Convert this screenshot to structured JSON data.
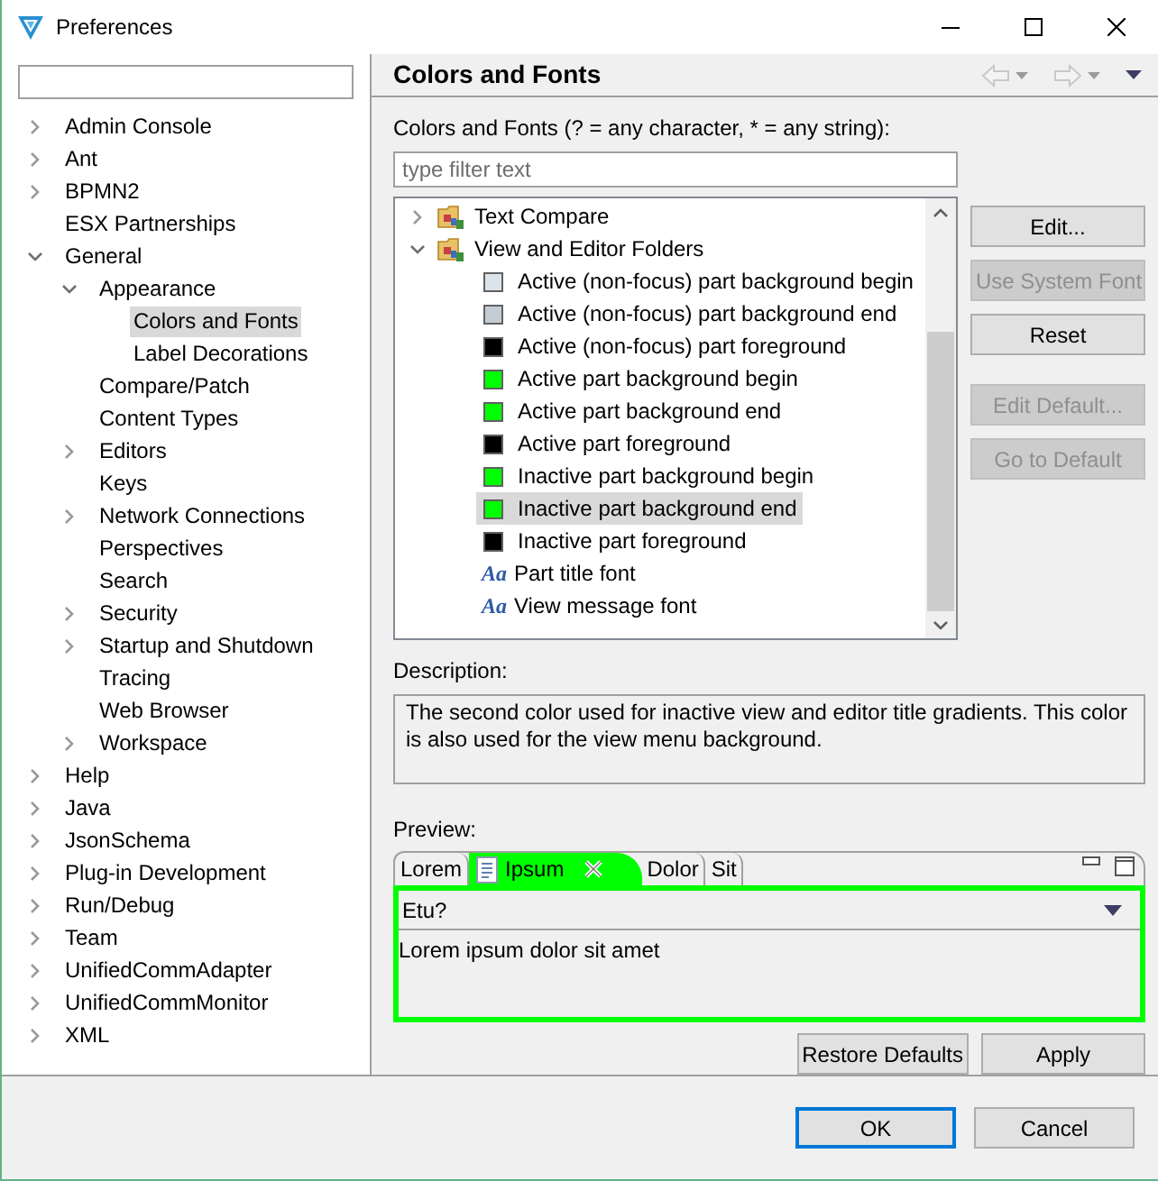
{
  "window": {
    "title": "Preferences"
  },
  "nav_tree": [
    {
      "label": "Admin Console",
      "expanded": false,
      "selected": false
    },
    {
      "label": "Ant",
      "expanded": false,
      "selected": false
    },
    {
      "label": "BPMN2",
      "expanded": false,
      "selected": false
    },
    {
      "label": "ESX Partnerships",
      "selected": false
    },
    {
      "label": "General",
      "expanded": true,
      "selected": false,
      "children": [
        {
          "label": "Appearance",
          "expanded": true,
          "selected": false,
          "children": [
            {
              "label": "Colors and Fonts",
              "selected": true
            },
            {
              "label": "Label Decorations",
              "selected": false
            }
          ]
        },
        {
          "label": "Compare/Patch",
          "selected": false
        },
        {
          "label": "Content Types",
          "selected": false
        },
        {
          "label": "Editors",
          "expanded": false,
          "selected": false
        },
        {
          "label": "Keys",
          "selected": false
        },
        {
          "label": "Network Connections",
          "expanded": false,
          "selected": false
        },
        {
          "label": "Perspectives",
          "selected": false
        },
        {
          "label": "Search",
          "selected": false
        },
        {
          "label": "Security",
          "expanded": false,
          "selected": false
        },
        {
          "label": "Startup and Shutdown",
          "expanded": false,
          "selected": false
        },
        {
          "label": "Tracing",
          "selected": false
        },
        {
          "label": "Web Browser",
          "selected": false
        },
        {
          "label": "Workspace",
          "expanded": false,
          "selected": false
        }
      ]
    },
    {
      "label": "Help",
      "expanded": false,
      "selected": false
    },
    {
      "label": "Java",
      "expanded": false,
      "selected": false
    },
    {
      "label": "JsonSchema",
      "expanded": false,
      "selected": false
    },
    {
      "label": "Plug-in Development",
      "expanded": false,
      "selected": false
    },
    {
      "label": "Run/Debug",
      "expanded": false,
      "selected": false
    },
    {
      "label": "Team",
      "expanded": false,
      "selected": false
    },
    {
      "label": "UnifiedCommAdapter",
      "expanded": false,
      "selected": false
    },
    {
      "label": "UnifiedCommMonitor",
      "expanded": false,
      "selected": false
    },
    {
      "label": "XML",
      "expanded": false,
      "selected": false
    }
  ],
  "page": {
    "title": "Colors and Fonts",
    "filter_label": "Colors and Fonts (? = any character, * = any string):",
    "filter_placeholder": "type filter text",
    "tree": [
      {
        "kind": "category",
        "label": "Text Compare",
        "expanded": false,
        "selected": false
      },
      {
        "kind": "category",
        "label": "View and Editor Folders",
        "expanded": true,
        "selected": false,
        "children": [
          {
            "kind": "color",
            "label": "Active (non-focus) part background begin",
            "color": "#dde3ea",
            "selected": false
          },
          {
            "kind": "color",
            "label": "Active (non-focus) part background end",
            "color": "#c4ccd5",
            "selected": false
          },
          {
            "kind": "color",
            "label": "Active (non-focus) part foreground",
            "color": "#000000",
            "selected": false
          },
          {
            "kind": "color",
            "label": "Active part background begin",
            "color": "#00ff00",
            "selected": false
          },
          {
            "kind": "color",
            "label": "Active part background end",
            "color": "#00ff00",
            "selected": false
          },
          {
            "kind": "color",
            "label": "Active part foreground",
            "color": "#000000",
            "selected": false
          },
          {
            "kind": "color",
            "label": "Inactive part background begin",
            "color": "#00ff00",
            "selected": false
          },
          {
            "kind": "color",
            "label": "Inactive part background end",
            "color": "#00ff00",
            "selected": true
          },
          {
            "kind": "color",
            "label": "Inactive part foreground",
            "color": "#000000",
            "selected": false
          },
          {
            "kind": "font",
            "glyph": "Aa",
            "label": "Part title font",
            "selected": false
          },
          {
            "kind": "font",
            "glyph": "Aa",
            "label": "View message font",
            "selected": false
          }
        ]
      }
    ],
    "side_buttons": [
      {
        "label": "Edit...",
        "disabled": false
      },
      {
        "label": "Use System Font",
        "disabled": true
      },
      {
        "label": "Reset",
        "disabled": false
      },
      {
        "label": "Edit Default...",
        "disabled": true
      },
      {
        "label": "Go to Default",
        "disabled": true
      }
    ],
    "description_label": "Description:",
    "description": "The second color used for inactive view and editor title gradients. This color is also used for the view menu background.",
    "preview_label": "Preview:",
    "preview": {
      "tabs": [
        {
          "label": "Lorem",
          "selected": false
        },
        {
          "label": "Ipsum",
          "selected": true
        },
        {
          "label": "Dolor",
          "selected": false
        },
        {
          "label": "Sit",
          "selected": false
        }
      ],
      "combo": "Etu?",
      "text": "Lorem ipsum dolor sit amet"
    },
    "page_buttons": [
      "Restore Defaults",
      "Apply"
    ]
  },
  "dialog_buttons": [
    {
      "label": "OK",
      "default": true
    },
    {
      "label": "Cancel",
      "default": false
    }
  ]
}
